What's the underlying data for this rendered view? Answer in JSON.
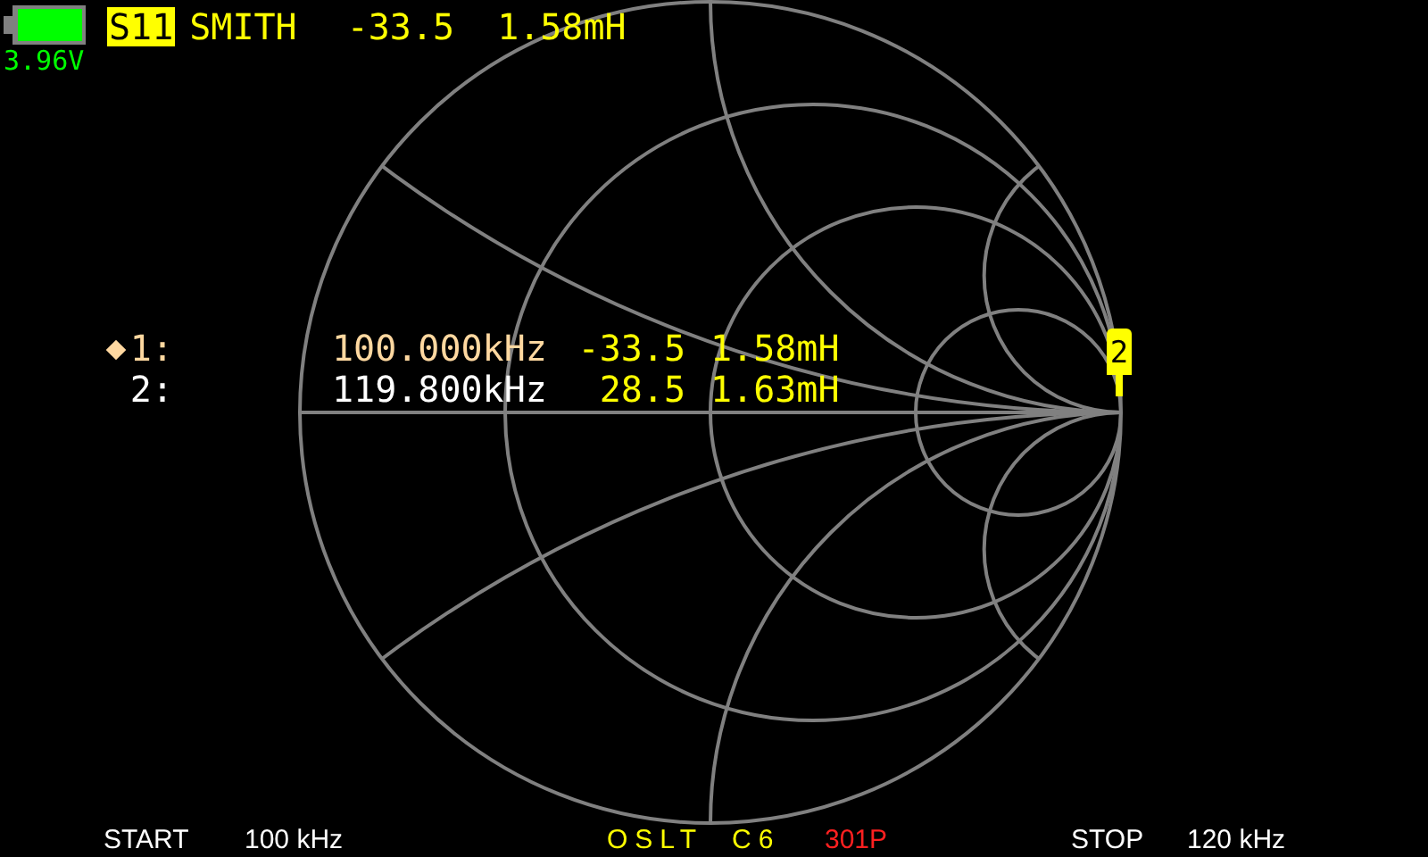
{
  "battery": {
    "voltage": "3.96V"
  },
  "trace": {
    "label": "S11",
    "format": "SMITH",
    "value": "-33.5",
    "reading": "1.58mH"
  },
  "markers": [
    {
      "label": "1:",
      "selected": true,
      "frequency": "100.000kHz",
      "value": "-33.5",
      "reading": "1.58mH"
    },
    {
      "label": "2:",
      "selected": false,
      "frequency": "119.800kHz",
      "value": "28.5",
      "reading": "1.63mH"
    }
  ],
  "chart_marker": {
    "label": "2"
  },
  "footer": {
    "start_label": "START",
    "start": "100 kHz",
    "calibration": "OSLT",
    "cal_slot": "C6",
    "points": "301P",
    "stop_label": "STOP",
    "stop": "120 kHz"
  }
}
